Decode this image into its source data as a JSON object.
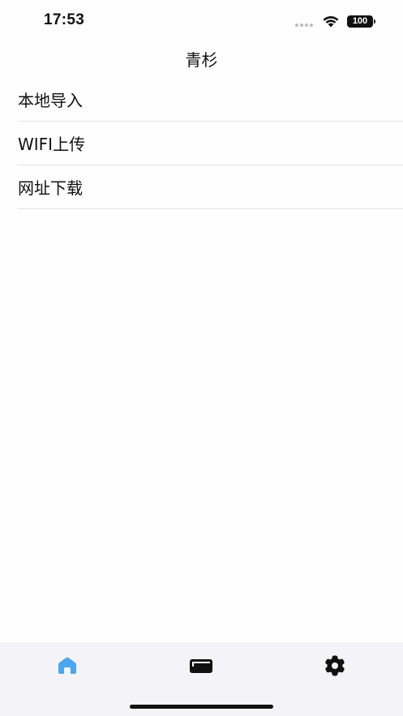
{
  "status_bar": {
    "time": "17:53",
    "battery": "100"
  },
  "nav": {
    "title": "青杉"
  },
  "menu": {
    "items": [
      {
        "label": "本地导入"
      },
      {
        "label": "WIFI上传"
      },
      {
        "label": "网址下载"
      }
    ]
  },
  "tab_bar": {
    "active_color": "#4aa6ee",
    "inactive_color": "#111111",
    "tabs": [
      {
        "icon": "home-icon",
        "active": true
      },
      {
        "icon": "card-icon",
        "active": false
      },
      {
        "icon": "gear-icon",
        "active": false
      }
    ]
  }
}
